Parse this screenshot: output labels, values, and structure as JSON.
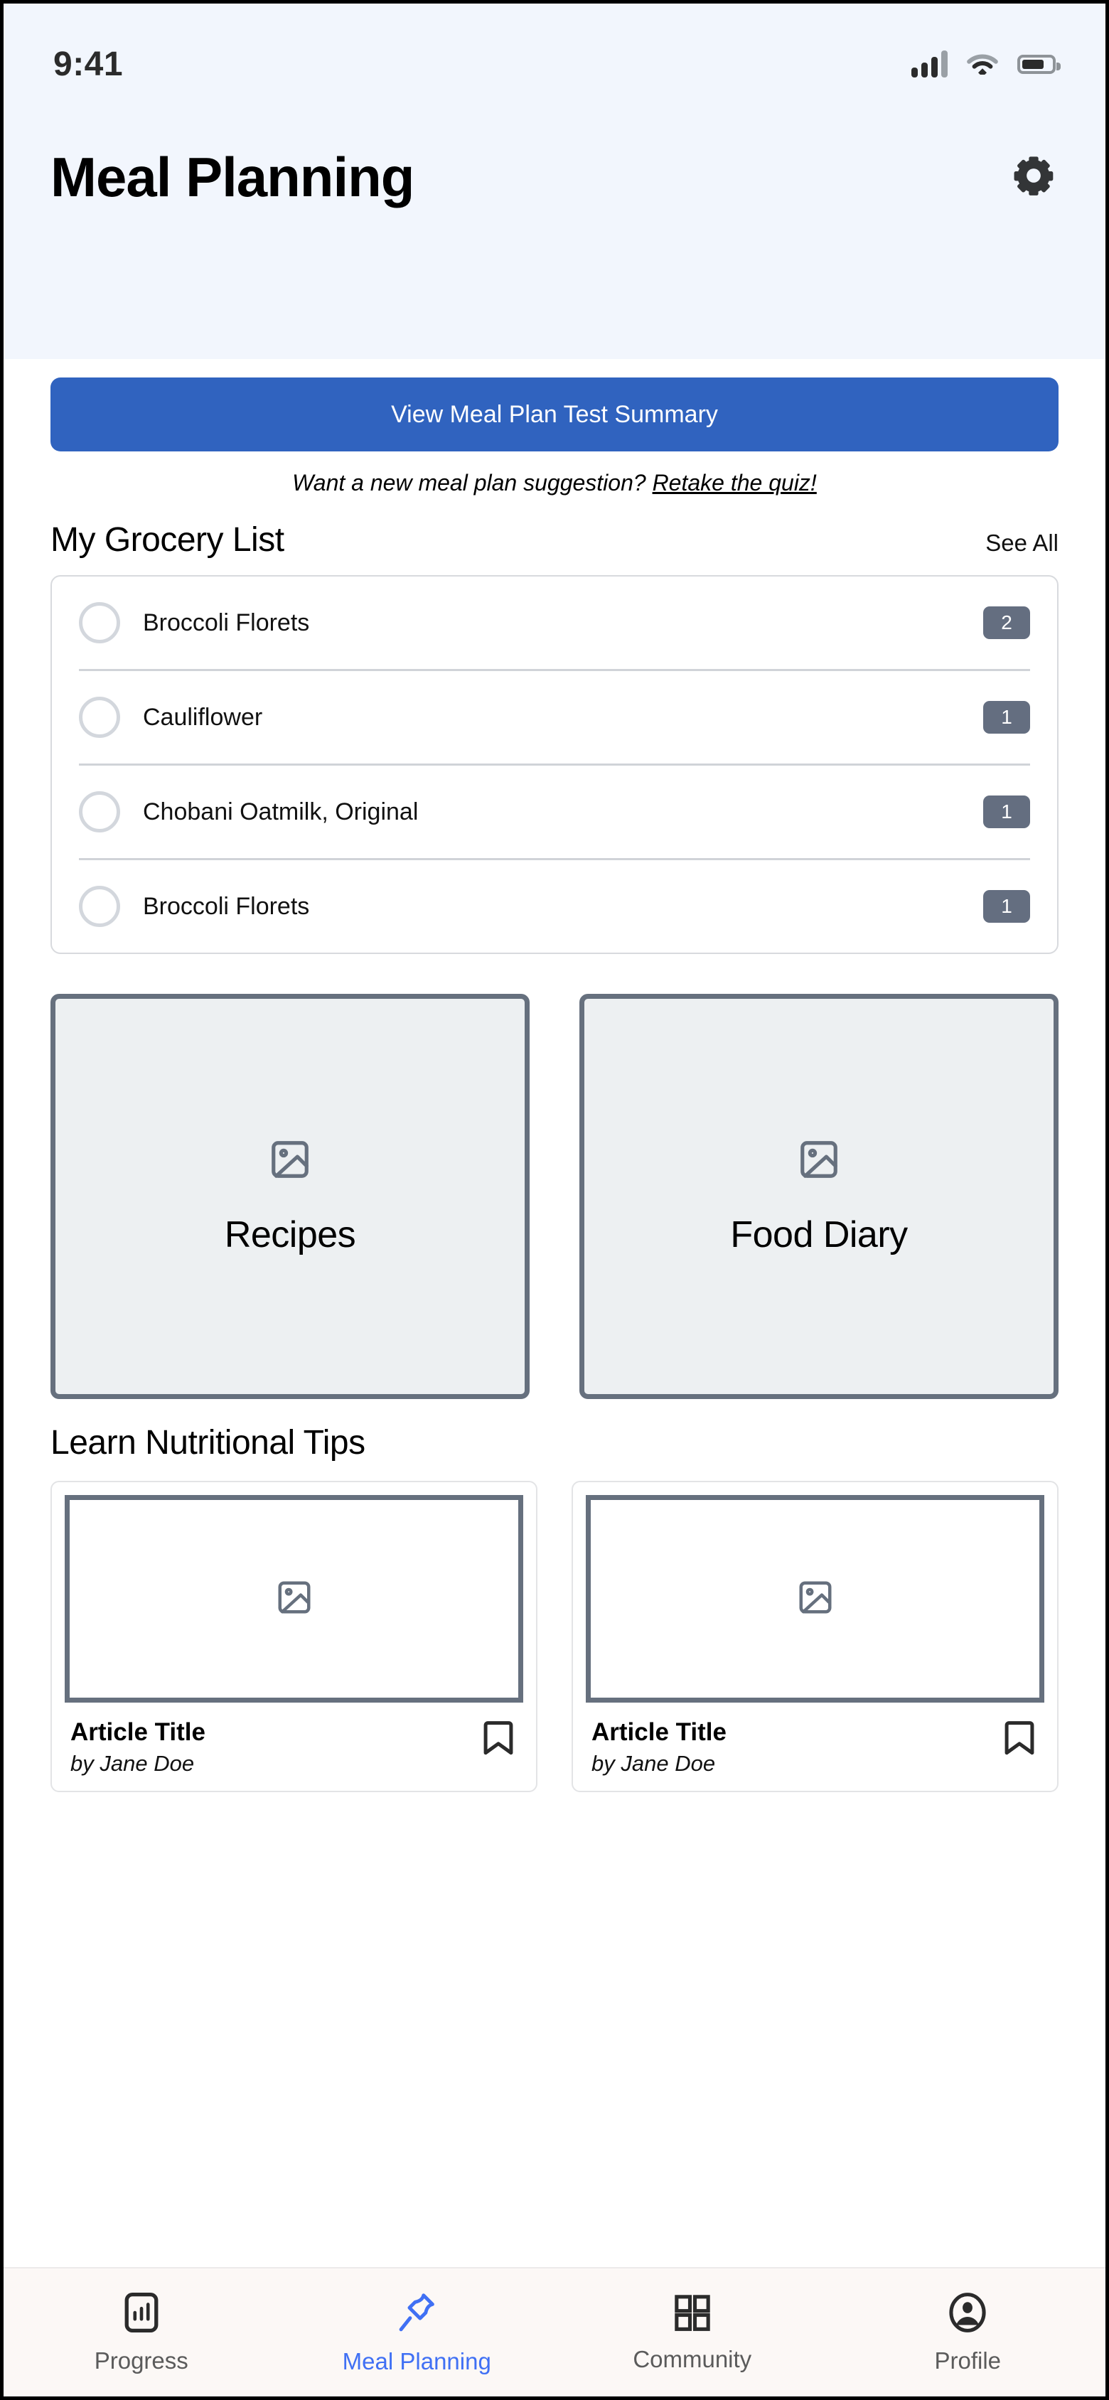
{
  "status_bar": {
    "time": "9:41",
    "signal_icon": "cellular-signal-icon",
    "wifi_icon": "wifi-icon",
    "battery_icon": "battery-icon"
  },
  "header": {
    "title": "Meal Planning",
    "settings_icon": "gear-icon"
  },
  "main": {
    "cta_label": "View Meal Plan Test Summary",
    "quiz_prompt": "Want a new meal plan suggestion? ",
    "quiz_link": "Retake the quiz!",
    "grocery": {
      "title": "My Grocery List",
      "see_all": "See All",
      "items": [
        {
          "name": "Broccoli Florets",
          "qty": "2"
        },
        {
          "name": "Cauliflower",
          "qty": "1"
        },
        {
          "name": "Chobani Oatmilk, Original",
          "qty": "1"
        },
        {
          "name": "Broccoli Florets",
          "qty": "1"
        }
      ]
    },
    "tiles": [
      {
        "label": "Recipes",
        "icon": "image-placeholder-icon"
      },
      {
        "label": "Food Diary",
        "icon": "image-placeholder-icon"
      }
    ],
    "tips": {
      "title": "Learn Nutritional Tips",
      "articles": [
        {
          "title": "Article Title",
          "author": "by Jane Doe",
          "thumb_icon": "image-placeholder-icon",
          "bookmark_icon": "bookmark-icon"
        },
        {
          "title": "Article Title",
          "author": "by Jane Doe",
          "thumb_icon": "image-placeholder-icon",
          "bookmark_icon": "bookmark-icon"
        }
      ]
    }
  },
  "tab_bar": {
    "active": "Meal Planning",
    "tabs": [
      {
        "label": "Progress",
        "icon": "bar-chart-icon"
      },
      {
        "label": "Meal Planning",
        "icon": "pin-icon"
      },
      {
        "label": "Community",
        "icon": "grid-icon"
      },
      {
        "label": "Profile",
        "icon": "person-circle-icon"
      }
    ]
  },
  "colors": {
    "header_band": "#f2f6fd",
    "accent_blue": "#3063bf",
    "active_tab_blue": "#4070f4",
    "badge_slate": "#646e80",
    "tile_border": "#66707e",
    "tile_fill": "#edf0f2",
    "tab_bar_bg": "#fcf8f6"
  }
}
